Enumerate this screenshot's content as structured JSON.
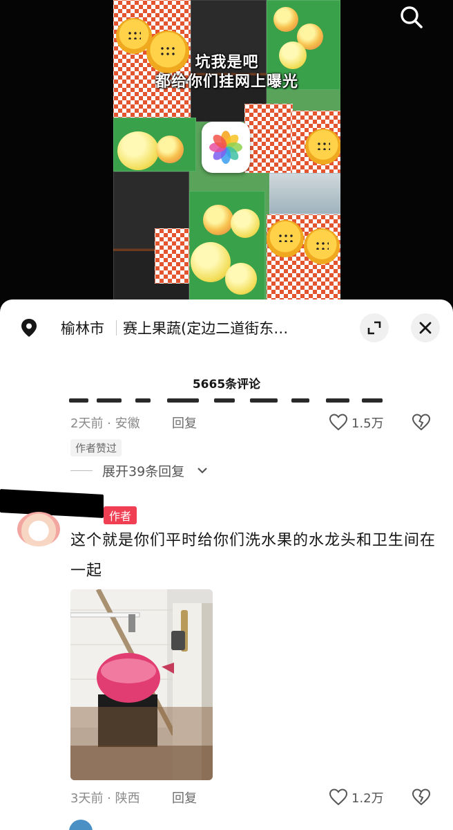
{
  "video": {
    "overlay_line1": "坑我是吧",
    "overlay_line2": "都给你们挂网上曝光",
    "search_icon": "search-icon",
    "photos_icon": "photos-app-icon"
  },
  "location": {
    "city": "榆林市",
    "shop": "赛上果蔬(定边二道街东…",
    "pin_icon": "location-pin-icon",
    "expand_icon": "expand-icon",
    "close_icon": "close-icon"
  },
  "comment_count": "5665条评论",
  "comments": [
    {
      "time_location": "2天前 · 安徽",
      "reply_label": "回复",
      "like_count": "1.5万",
      "liked_by_author_tag": "作者赞过",
      "expand_replies_label": "展开39条回复"
    },
    {
      "author_badge": "作者",
      "text": "这个就是你们平时给你们洗水果的水龙头和卫生间在一起",
      "time_location": "3天前 · 陕西",
      "reply_label": "回复",
      "like_count": "1.2万"
    }
  ],
  "colors": {
    "author_badge": "#f03e52",
    "sheet_bg": "#ffffff",
    "video_bg": "#050505"
  }
}
